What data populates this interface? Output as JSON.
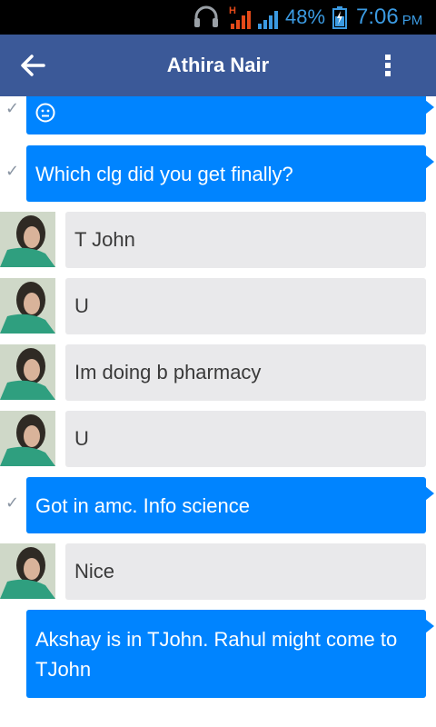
{
  "status_bar": {
    "network_type": "H",
    "battery_percent": "48%",
    "time": "7:06",
    "ampm": "PM",
    "icons": [
      "headset-icon",
      "network-icon",
      "signal-icon",
      "battery-icon"
    ]
  },
  "header": {
    "title": "Athira Nair",
    "back_icon": "arrow-left-icon",
    "menu_icon": "more-vertical-icon"
  },
  "colors": {
    "header_bg": "#3b5998",
    "sent_bubble": "#0084ff",
    "received_bubble": "#e9e9eb",
    "status_bar_text": "#3b9ae1"
  },
  "messages": [
    {
      "direction": "sent",
      "type": "emoji",
      "emoji": "neutral-face-icon",
      "status": "✓"
    },
    {
      "direction": "sent",
      "text": "Which clg did you get finally?",
      "status": "✓"
    },
    {
      "direction": "received",
      "text": "T John"
    },
    {
      "direction": "received",
      "text": "U"
    },
    {
      "direction": "received",
      "text": "Im doing b pharmacy"
    },
    {
      "direction": "received",
      "text": "U"
    },
    {
      "direction": "sent",
      "text": "Got in amc. Info science",
      "status": "✓"
    },
    {
      "direction": "received",
      "text": "Nice"
    },
    {
      "direction": "sent",
      "text": "Akshay is in TJohn. Rahul might come to TJohn"
    }
  ]
}
